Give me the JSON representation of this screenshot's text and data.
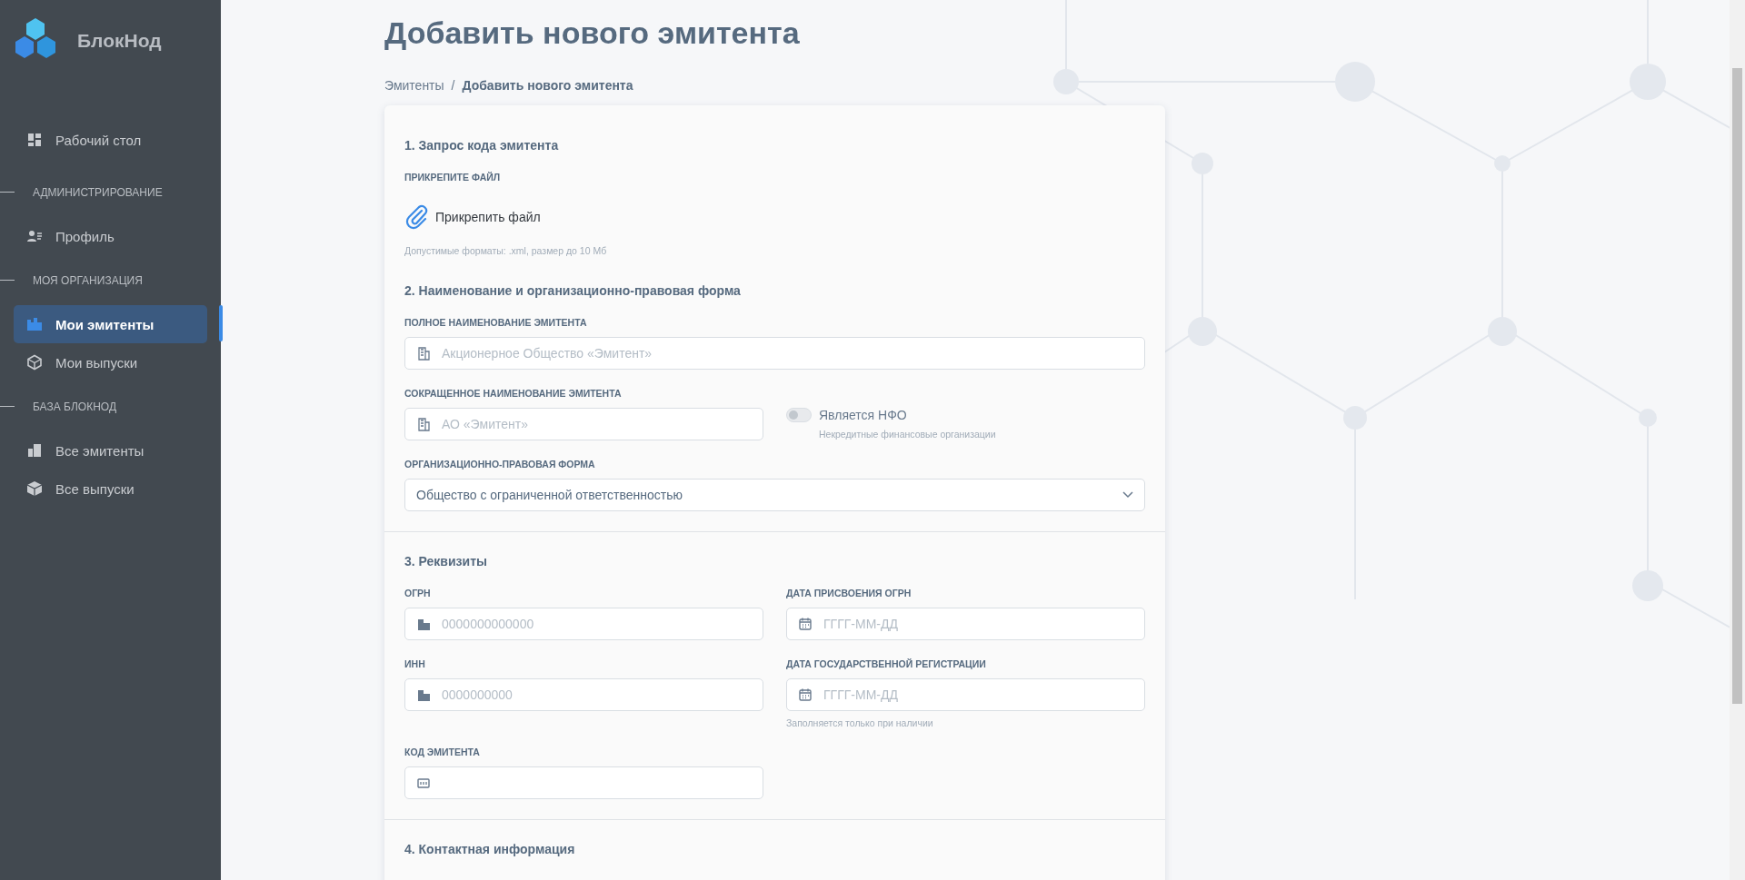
{
  "sidebar": {
    "brand": "БлокНод",
    "groups": [
      {
        "items": [
          {
            "label": "Рабочий стол",
            "selected": false
          }
        ]
      },
      {
        "title": "АДМИНИСТРИРОВАНИЕ",
        "items": [
          {
            "label": "Профиль",
            "selected": false
          }
        ]
      },
      {
        "title": "МОЯ ОРГАНИЗАЦИЯ",
        "items": [
          {
            "label": "Мои эмитенты",
            "selected": true
          },
          {
            "label": "Мои выпуски",
            "selected": false
          }
        ]
      },
      {
        "title": "БАЗА БЛОКНОД",
        "items": [
          {
            "label": "Все эмитенты",
            "selected": false
          },
          {
            "label": "Все выпуски",
            "selected": false
          }
        ]
      }
    ]
  },
  "page": {
    "title": "Добавить нового эмитента",
    "breadcrumb": [
      "Эмитенты",
      "Добавить нового эмитента"
    ],
    "breadcrumb_separator": "/"
  },
  "form": {
    "sections": [
      {
        "heading": "1. Запрос кода эмитента",
        "fields": [
          {
            "kind": "file",
            "label": "ПРИКРЕПИТЕ ФАЙЛ",
            "button": "Прикрепить файл",
            "hint": "Допустимые форматы: .xml, размер до 10 Мб"
          }
        ]
      },
      {
        "heading": "2. Наименование и организационно-правовая форма",
        "fields": [
          {
            "kind": "name",
            "wide": true,
            "label": "ПОЛНОЕ НАИМЕНОВАНИЕ ЭМИТЕНТА",
            "placeholder": "Акционерное Общество «Эмитент»"
          },
          {
            "kind": "name",
            "label": "СОКРАЩЕННОЕ НАИМЕНОВАНИЕ ЭМИТЕНТА",
            "placeholder": "АО «Эмитент»"
          },
          {
            "kind": "toggle",
            "label": "Является НФО",
            "hint": "Некредитные финансовые организации",
            "on": false
          },
          {
            "kind": "select",
            "wide": true,
            "label": "ОРГАНИЗАЦИОННО-ПРАВОВАЯ ФОРМА",
            "value": "Общество с ограниченной ответственностью"
          }
        ]
      },
      {
        "heading": "3. Реквизиты",
        "fields": [
          {
            "kind": "number",
            "label": "ОГРН",
            "placeholder": "0000000000000"
          },
          {
            "kind": "date",
            "label": "ДАТА ПРИСВОЕНИЯ ОГРН",
            "placeholder": "ГГГГ-ММ-ДД"
          },
          {
            "kind": "number",
            "label": "ИНН",
            "placeholder": "0000000000"
          },
          {
            "kind": "date",
            "label": "ДАТА ГОСУДАРСТВЕННОЙ РЕГИСТРАЦИИ",
            "placeholder": "ГГГГ-ММ-ДД",
            "hint": "Заполняется только при наличии"
          },
          {
            "kind": "code",
            "label": "КОД ЭМИТЕНТА"
          }
        ]
      },
      {
        "heading": "4. Контактная информация"
      }
    ]
  }
}
